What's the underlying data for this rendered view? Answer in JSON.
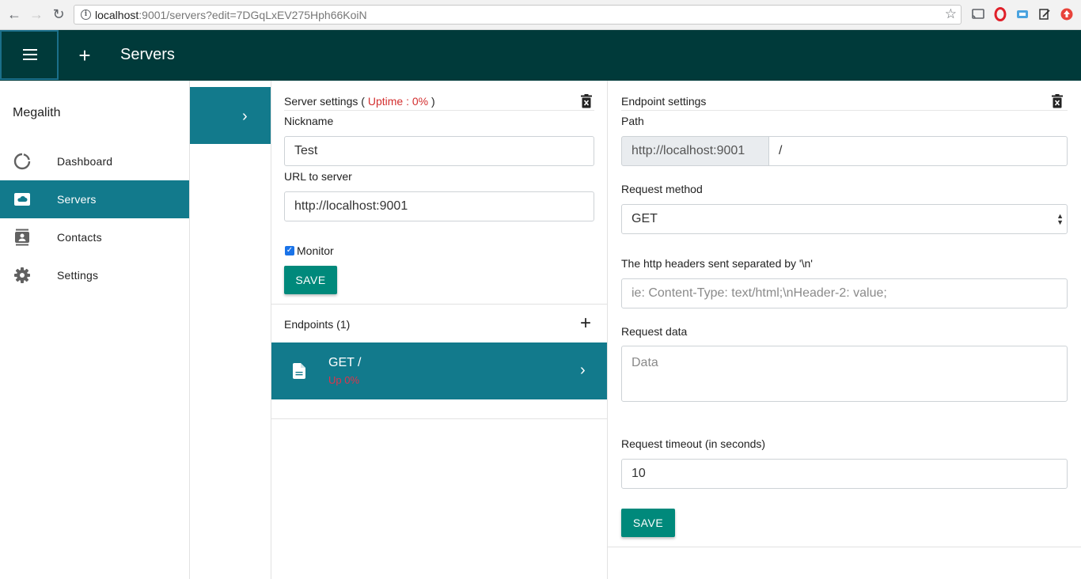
{
  "browser": {
    "url_host": "localhost",
    "url_rest": ":9001/servers?edit=7DGqLxEV275Hph66KoiN"
  },
  "appbar": {
    "title": "Servers"
  },
  "sidebar": {
    "brand": "Megalith",
    "items": [
      {
        "label": "Dashboard",
        "icon": "loading-circle-icon"
      },
      {
        "label": "Servers",
        "icon": "cloud-server-icon"
      },
      {
        "label": "Contacts",
        "icon": "contacts-icon"
      },
      {
        "label": "Settings",
        "icon": "gear-icon"
      }
    ]
  },
  "server_settings": {
    "heading": "Server settings (",
    "uptime": "Uptime : 0%",
    "heading_close": ")",
    "nickname_label": "Nickname",
    "nickname_value": "Test",
    "url_label": "URL to server",
    "url_value": "http://localhost:9001",
    "monitor_label": "Monitor",
    "monitor_checked": true,
    "save_label": "SAVE",
    "endpoints_label": "Endpoints (1)",
    "endpoint": {
      "title": "GET /",
      "subtitle": "Up 0%"
    }
  },
  "endpoint_settings": {
    "heading": "Endpoint settings",
    "path_label": "Path",
    "path_prefix": "http://localhost:9001",
    "path_value": "/",
    "method_label": "Request method",
    "method_value": "GET",
    "headers_label": "The http headers sent separated by '\\n'",
    "headers_placeholder": "ie: Content-Type: text/html;\\nHeader-2: value;",
    "data_label": "Request data",
    "data_placeholder": "Data",
    "timeout_label": "Request timeout (in seconds)",
    "timeout_value": "10",
    "save_label": "SAVE"
  },
  "colors": {
    "appbar": "#003a3a",
    "accent": "#127a8c",
    "button": "#00897b",
    "danger": "#d32f2f"
  }
}
